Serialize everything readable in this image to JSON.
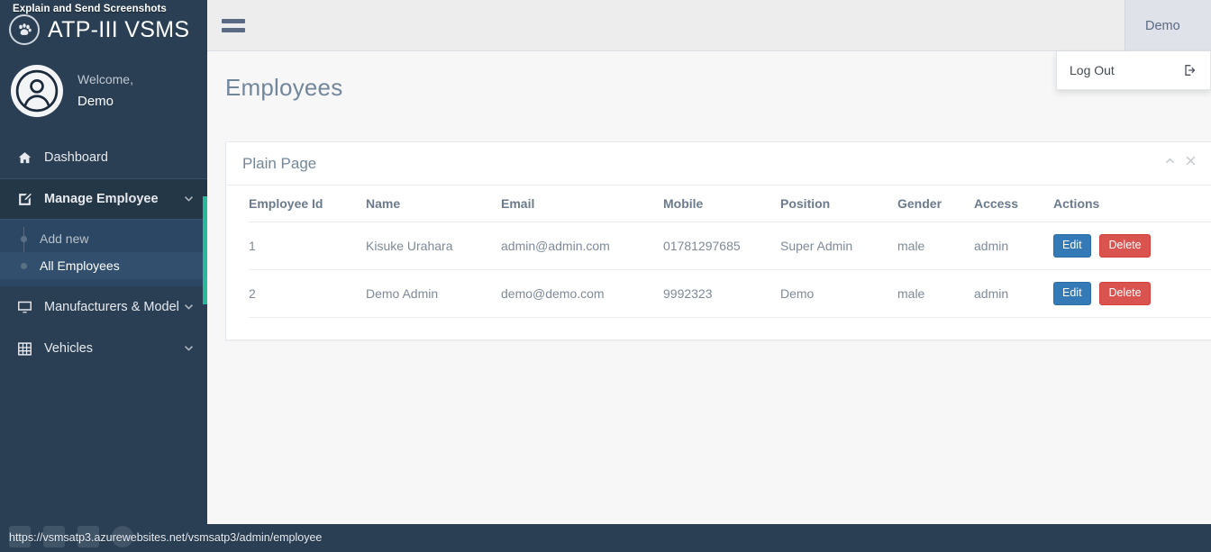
{
  "sidebar": {
    "brand_overlay": "Explain and Send Screenshots",
    "brand_title": "ATP-III VSMS",
    "brand_icon": "paw-icon",
    "profile": {
      "welcome": "Welcome,",
      "name": "Demo",
      "avatar_icon": "user-avatar-icon"
    },
    "items": [
      {
        "label": "Dashboard",
        "icon": "home-icon",
        "caret": false
      },
      {
        "label": "Manage Employee",
        "icon": "edit-square-icon",
        "caret": true
      },
      {
        "label": "Manufacturers & Model",
        "icon": "monitor-icon",
        "caret": true
      },
      {
        "label": "Vehicles",
        "icon": "grid-icon",
        "caret": true
      }
    ],
    "submenu": [
      {
        "label": "Add new",
        "active": false
      },
      {
        "label": "All Employees",
        "active": true
      }
    ],
    "accent_color": "#26b99a"
  },
  "topbar": {
    "menu_toggle_icon": "hamburger-icon",
    "user_menu_label": "Demo",
    "dropdown": {
      "label": "Log Out",
      "icon": "sign-out-icon"
    }
  },
  "main": {
    "page_title": "Employees",
    "panel": {
      "title": "Plain Page",
      "collapse_icon": "chevron-up-icon",
      "close_icon": "close-icon",
      "table": {
        "columns": [
          "Employee Id",
          "Name",
          "Email",
          "Mobile",
          "Position",
          "Gender",
          "Access",
          "Actions"
        ],
        "rows": [
          {
            "id": "1",
            "name": "Kisuke Urahara",
            "email": "admin@admin.com",
            "mobile": "01781297685",
            "position": "Super Admin",
            "gender": "male",
            "access": "admin",
            "edit_label": "Edit",
            "delete_label": "Delete"
          },
          {
            "id": "2",
            "name": "Demo Admin",
            "email": "demo@demo.com",
            "mobile": "9992323",
            "position": "Demo",
            "gender": "male",
            "access": "admin",
            "edit_label": "Edit",
            "delete_label": "Delete"
          }
        ]
      }
    }
  },
  "statusbar": {
    "url": "https://vsmsatp3.azurewebsites.net/vsmsatp3/admin/employee"
  },
  "colors": {
    "sidebar_bg": "#2a3f54",
    "accent": "#26b99a",
    "edit_button": "#337ab7",
    "delete_button": "#d9534f",
    "page_bg": "#f7f7f8",
    "topbar_bg": "#ededed"
  }
}
